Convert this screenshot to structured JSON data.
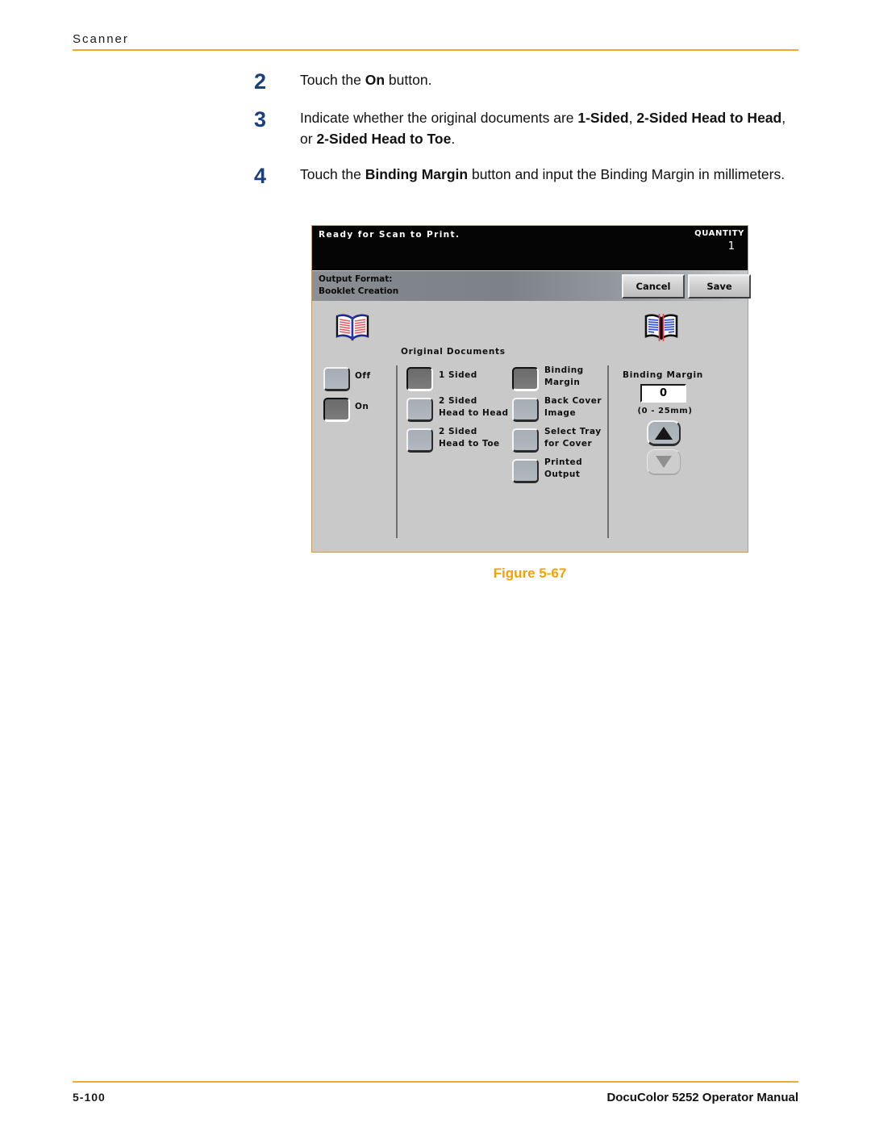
{
  "page": {
    "header_title": "Scanner",
    "footer_page_number": "5-100",
    "footer_title": "DocuColor 5252 Operator Manual",
    "figure_caption": "Figure 5-67",
    "accent_color": "#f2aa2e",
    "step_number_color": "#1c3f7e",
    "caption_color": "#f5a200"
  },
  "steps": [
    {
      "number": "2",
      "parts": [
        {
          "text": "Touch the ",
          "bold": false
        },
        {
          "text": "On",
          "bold": true
        },
        {
          "text": " button.",
          "bold": false
        }
      ]
    },
    {
      "number": "3",
      "parts": [
        {
          "text": "Indicate whether the original documents are ",
          "bold": false
        },
        {
          "text": "1-Sided",
          "bold": true
        },
        {
          "text": ", ",
          "bold": false
        },
        {
          "text": "2-Sided Head to Head",
          "bold": true
        },
        {
          "text": ", or ",
          "bold": false
        },
        {
          "text": "2-Sided Head to Toe",
          "bold": true
        },
        {
          "text": ".",
          "bold": false
        }
      ]
    },
    {
      "number": "4",
      "parts": [
        {
          "text": "Touch the ",
          "bold": false
        },
        {
          "text": "Binding Margin",
          "bold": true
        },
        {
          "text": " button and input the Binding Margin in millimeters.",
          "bold": false
        }
      ]
    }
  ],
  "scanner_ui": {
    "status_bar": {
      "message": "Ready  for  Scan  to  Print.",
      "quantity_label": "QUANTITY",
      "quantity_value": "1"
    },
    "format_bar": {
      "line1": "Output Format:",
      "line2": "Booklet Creation",
      "cancel_label": "Cancel",
      "save_label": "Save"
    },
    "icons": {
      "original_documents": "open-book-icon",
      "binding_margin": "open-book-with-margin-icon"
    },
    "column_power": {
      "buttons": [
        {
          "label": "Off",
          "selected": false
        },
        {
          "label": "On",
          "selected": true
        }
      ]
    },
    "column_original_documents": {
      "heading": "Original  Documents",
      "buttons": [
        {
          "label": "1  Sided",
          "selected": true
        },
        {
          "label": "2  Sided\nHead  to  Head",
          "selected": false
        },
        {
          "label": "2  Sided\nHead  to  Toe",
          "selected": false
        }
      ]
    },
    "column_options": {
      "buttons": [
        {
          "label": "Binding\nMargin",
          "selected": true
        },
        {
          "label": "Back  Cover\nImage",
          "selected": false
        },
        {
          "label": "Select  Tray\nfor  Cover",
          "selected": false
        },
        {
          "label": "Printed\nOutput",
          "selected": false
        }
      ]
    },
    "column_binding_margin": {
      "heading": "Binding  Margin",
      "value": "0",
      "range": "(0  -  25mm)",
      "up_arrow": "triangle-up-icon",
      "down_arrow": "triangle-down-icon"
    }
  }
}
